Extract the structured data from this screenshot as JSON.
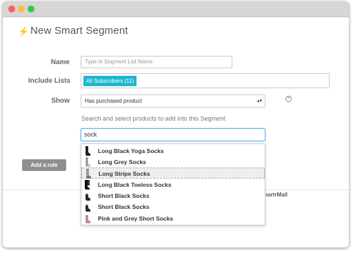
{
  "window": {
    "controls": [
      "close",
      "minimize",
      "maximize"
    ]
  },
  "header": {
    "title": "New Smart Segment",
    "icon": "lightning-icon"
  },
  "form": {
    "name": {
      "label": "Name",
      "value": "",
      "placeholder": "Type in Segment List Name"
    },
    "include_lists": {
      "label": "Include Lists",
      "selected": [
        "All Subscribers (11)"
      ]
    },
    "show": {
      "label": "Show",
      "selected": "Has purchased product"
    },
    "product_search": {
      "helper": "Search and select products to add into this Segment",
      "value": "sock"
    }
  },
  "dropdown": {
    "items": [
      {
        "label": "Long Black Yoga Socks",
        "highlighted": false,
        "thumb_color": "#222222"
      },
      {
        "label": "Long Grey Socks",
        "highlighted": false,
        "thumb_color": "#b8b8b8"
      },
      {
        "label": "Long Stripe Socks",
        "highlighted": true,
        "thumb_color": "#444444"
      },
      {
        "label": "Long Black Toeless Socks",
        "highlighted": false,
        "thumb_color": "#1a1a1a"
      },
      {
        "label": "Short Black Socks",
        "highlighted": false,
        "thumb_color": "#2a2a2a"
      },
      {
        "label": "Short Black Socks",
        "highlighted": false,
        "thumb_color": "#2a2a2a"
      },
      {
        "label": "Pink and Grey Short Socks",
        "highlighted": false,
        "thumb_color": "#c98a8a"
      }
    ]
  },
  "actions": {
    "add_rule": "Add a rule"
  },
  "footer": {
    "brand": "martrMail"
  },
  "colors": {
    "accent": "#1fb6cf",
    "focus": "#54b4ec",
    "button": "#8f8f8f",
    "bolt": "#f2b22b"
  }
}
